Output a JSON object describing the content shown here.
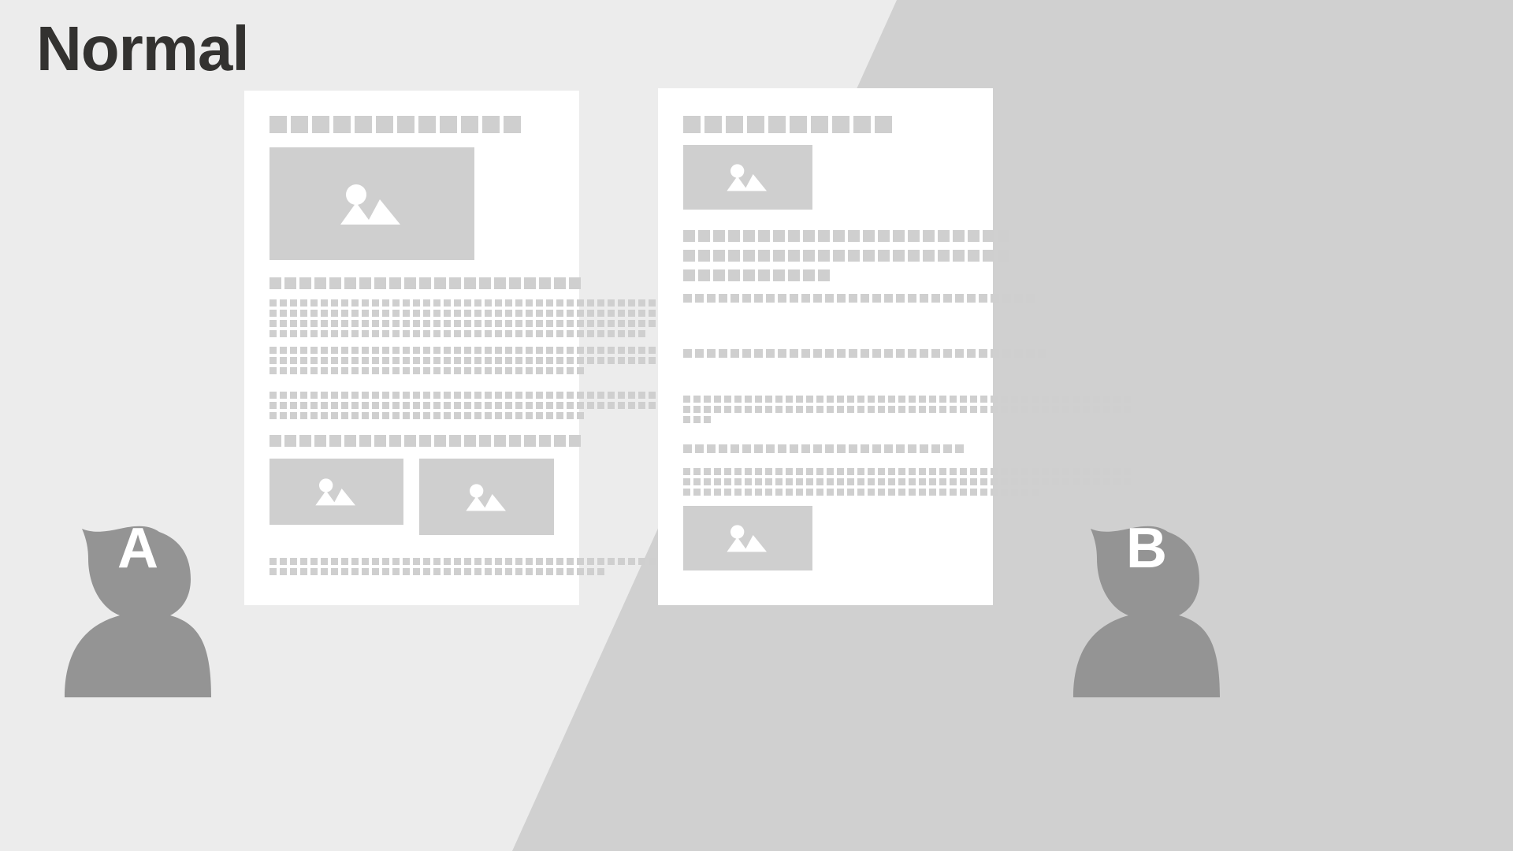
{
  "page": {
    "title": "Normal",
    "background_left_color": "#ececec",
    "background_right_color": "#d0d0d0",
    "placeholder_color": "#cfcfcf",
    "document_color": "#ffffff",
    "title_color": "#333230",
    "avatar_color": "#949494",
    "avatar_letter_color": "#ffffff"
  },
  "documents": [
    {
      "id": "document-a",
      "name": "left-document",
      "title_blocks": 12,
      "sections": [
        {
          "type": "image",
          "name": "hero-image",
          "icon": "image-placeholder-icon"
        },
        {
          "type": "heading",
          "name": "heading-1",
          "blocks": 21
        },
        {
          "type": "paragraph",
          "name": "paragraph-1",
          "lines": [
            44,
            44,
            44,
            37
          ]
        },
        {
          "type": "paragraph",
          "name": "paragraph-2",
          "lines": [
            44,
            44,
            31
          ]
        },
        {
          "type": "paragraph",
          "name": "paragraph-3",
          "lines": [
            42,
            42,
            31
          ]
        },
        {
          "type": "heading",
          "name": "heading-2",
          "blocks": 21
        },
        {
          "type": "image-pair",
          "name": "image-pair",
          "icon": "image-placeholder-icon"
        },
        {
          "type": "paragraph",
          "name": "paragraph-4",
          "lines": [
            44,
            33
          ]
        }
      ]
    },
    {
      "id": "document-b",
      "name": "right-document",
      "title_blocks": 10,
      "sections": [
        {
          "type": "image",
          "name": "hero-image",
          "icon": "image-placeholder-icon"
        },
        {
          "type": "heading",
          "name": "heading-1",
          "lines": [
            22,
            22,
            10
          ]
        },
        {
          "type": "lead",
          "name": "lead-line",
          "blocks": 30
        },
        {
          "type": "lead",
          "name": "lead-line-2",
          "blocks": 31
        },
        {
          "type": "paragraph",
          "name": "paragraph-1",
          "lines": [
            44,
            44,
            3
          ]
        },
        {
          "type": "lead",
          "name": "lead-line-3",
          "blocks": 24
        },
        {
          "type": "paragraph",
          "name": "paragraph-2",
          "lines": [
            44,
            44,
            35
          ]
        },
        {
          "type": "image",
          "name": "footer-image",
          "icon": "image-placeholder-icon"
        }
      ]
    }
  ],
  "avatars": [
    {
      "id": "avatar-a",
      "name": "avatar-person-a",
      "letter": "A",
      "side": "left"
    },
    {
      "id": "avatar-b",
      "name": "avatar-person-b",
      "letter": "B",
      "side": "right"
    }
  ]
}
